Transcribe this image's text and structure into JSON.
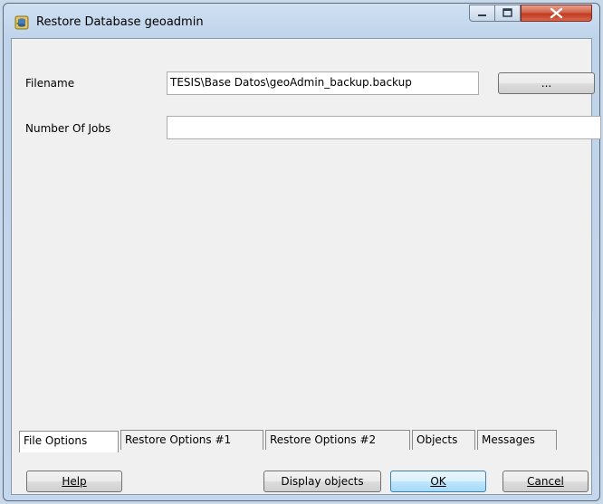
{
  "window": {
    "title": "Restore Database geoadmin",
    "minimize_icon": "minimize-icon",
    "maximize_icon": "maximize-icon",
    "close_icon": "close-icon",
    "app_icon": "database-restore-icon"
  },
  "form": {
    "filename_label": "Filename",
    "filename_value": "TESIS\\Base Datos\\geoAdmin_backup.backup",
    "browse_label": "...",
    "jobs_label": "Number Of Jobs",
    "jobs_value": ""
  },
  "tabs": [
    {
      "label": "File Options",
      "active": true
    },
    {
      "label": "Restore Options #1",
      "active": false
    },
    {
      "label": "Restore Options #2",
      "active": false
    },
    {
      "label": "Objects",
      "active": false
    },
    {
      "label": "Messages",
      "active": false
    }
  ],
  "buttons": {
    "help": "Help",
    "display_objects": "Display objects",
    "ok": "OK",
    "cancel": "Cancel"
  },
  "colors": {
    "close_button": "#c03b22",
    "ok_border": "#3c7fb1"
  }
}
